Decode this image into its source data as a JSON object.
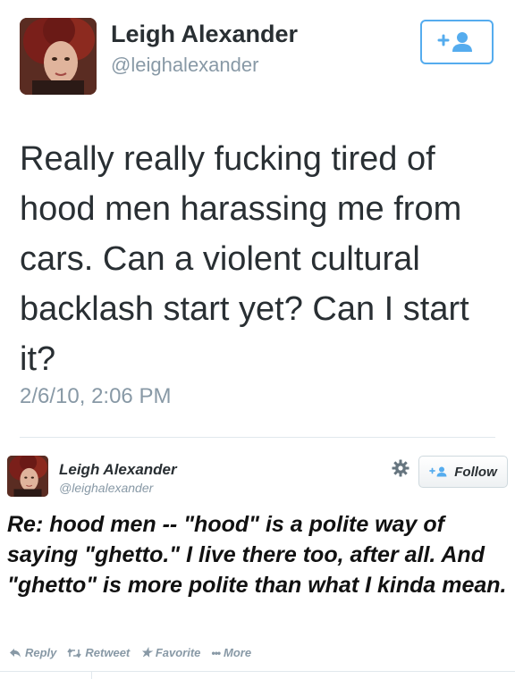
{
  "tweet1": {
    "author_name": "Leigh Alexander",
    "author_handle": "@leighalexander",
    "follow_icon": "add-user-icon",
    "text": "Really really fucking tired of hood men harassing me from cars. Can a violent cultural backlash start yet? Can I start it?",
    "timestamp": "2/6/10, 2:06 PM"
  },
  "tweet2": {
    "author_name": "Leigh Alexander",
    "author_handle": "@leighalexander",
    "follow_label": "Follow",
    "text": "Re: hood men -- \"hood\" is a polite way of saying \"ghetto.\" I live there too, after all. And \"ghetto\" is more polite than what I kinda mean.",
    "actions": {
      "reply": "Reply",
      "retweet": "Retweet",
      "favorite": "Favorite",
      "more": "More"
    }
  },
  "colors": {
    "twitter_blue": "#55acee",
    "muted_gray": "#8899a6",
    "text_dark": "#292f33"
  }
}
